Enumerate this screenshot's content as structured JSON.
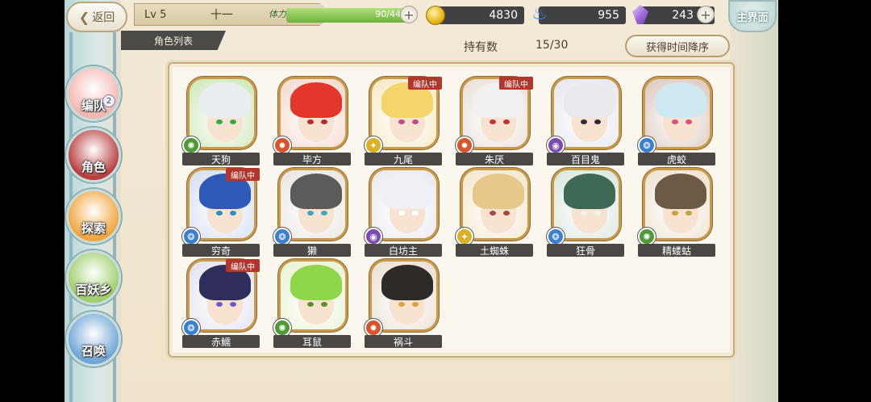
{
  "header": {
    "back_label": "返回",
    "level": "Lv 5",
    "player_name": "十一",
    "stamina_label": "体力",
    "stamina_text": "90/44",
    "stamina_fraction": 1.0,
    "coins": "4830",
    "souls": "955",
    "crystals": "243",
    "home_label": "主界面"
  },
  "list_header": {
    "tab_label": "角色列表",
    "hold_label": "持有数",
    "hold_count": "15/30",
    "sort_label": "获得时间降序"
  },
  "nav": {
    "items": [
      {
        "label": "编队",
        "badge": "2",
        "color": "#f4b7b0"
      },
      {
        "label": "角色",
        "badge": "",
        "color": "#b93e3e"
      },
      {
        "label": "探索",
        "badge": "",
        "color": "#f1a43c"
      },
      {
        "label": "百妖乡",
        "badge": "",
        "color": "#9fcf6a"
      },
      {
        "label": "召唤",
        "badge": "",
        "color": "#6fa6d6"
      }
    ]
  },
  "characters": [
    {
      "name": "天狗",
      "hair": "#e9eef0",
      "bg": "#c9e7b3",
      "eye": "#3aa74a",
      "element": "wind",
      "elem_color": "#4f9a35",
      "tag": ""
    },
    {
      "name": "毕方",
      "hair": "#e2362d",
      "bg": "#f2d7c9",
      "eye": "#b22d2d",
      "element": "fire",
      "elem_color": "#d9542a",
      "tag": ""
    },
    {
      "name": "九尾",
      "hair": "#f3d569",
      "bg": "#f5e7c0",
      "eye": "#c34a84",
      "element": "light",
      "elem_color": "#d9b22a",
      "tag": "编队中"
    },
    {
      "name": "朱厌",
      "hair": "#f0f0ee",
      "bg": "#e8ddd5",
      "eye": "#c33131",
      "element": "fire",
      "elem_color": "#d9542a",
      "tag": "编队中"
    },
    {
      "name": "百目鬼",
      "hair": "#e8eaee",
      "bg": "#e4e6ec",
      "eye": "#2c2c3a",
      "element": "dark",
      "elem_color": "#7a4bb0",
      "tag": ""
    },
    {
      "name": "虎蛟",
      "hair": "#cfe9f2",
      "bg": "#d9c4b8",
      "eye": "#d9507a",
      "element": "water",
      "elem_color": "#3a7fd0",
      "tag": ""
    },
    {
      "name": "穷奇",
      "hair": "#2f59b8",
      "bg": "#d1dcf1",
      "eye": "#2a8dc7",
      "element": "water",
      "elem_color": "#3a7fd0",
      "tag": "编队中"
    },
    {
      "name": "獭",
      "hair": "#5d5b5a",
      "bg": "#e8e4df",
      "eye": "#3ea7c0",
      "element": "water",
      "elem_color": "#3a7fd0",
      "tag": ""
    },
    {
      "name": "白坊主",
      "hair": "#eef0f4",
      "bg": "#e7e8ee",
      "eye": "#ffffff",
      "element": "dark",
      "elem_color": "#7a4bb0",
      "tag": ""
    },
    {
      "name": "土蜘蛛",
      "hair": "#e6c98a",
      "bg": "#f3e6c9",
      "eye": "#a34a3a",
      "element": "light",
      "elem_color": "#d9b22a",
      "tag": ""
    },
    {
      "name": "狂骨",
      "hair": "#3e6a55",
      "bg": "#d7e5dc",
      "eye": "#f1f1f1",
      "element": "water",
      "elem_color": "#3a7fd0",
      "tag": ""
    },
    {
      "name": "精蝼蛄",
      "hair": "#6c5a45",
      "bg": "#ece0cc",
      "eye": "#c8a13a",
      "element": "wind",
      "elem_color": "#4f9a35",
      "tag": ""
    },
    {
      "name": "赤鱬",
      "hair": "#2f2d5a",
      "bg": "#dfe0f0",
      "eye": "#6b5bc7",
      "element": "water",
      "elem_color": "#3a7fd0",
      "tag": "编队中"
    },
    {
      "name": "耳鼠",
      "hair": "#8fd64a",
      "bg": "#e6f2cf",
      "eye": "#5a8f2a",
      "element": "wind",
      "elem_color": "#4f9a35",
      "tag": ""
    },
    {
      "name": "祸斗",
      "hair": "#2e2a28",
      "bg": "#e9ddcf",
      "eye": "#d9a23a",
      "element": "fire",
      "elem_color": "#d9542a",
      "tag": ""
    }
  ]
}
